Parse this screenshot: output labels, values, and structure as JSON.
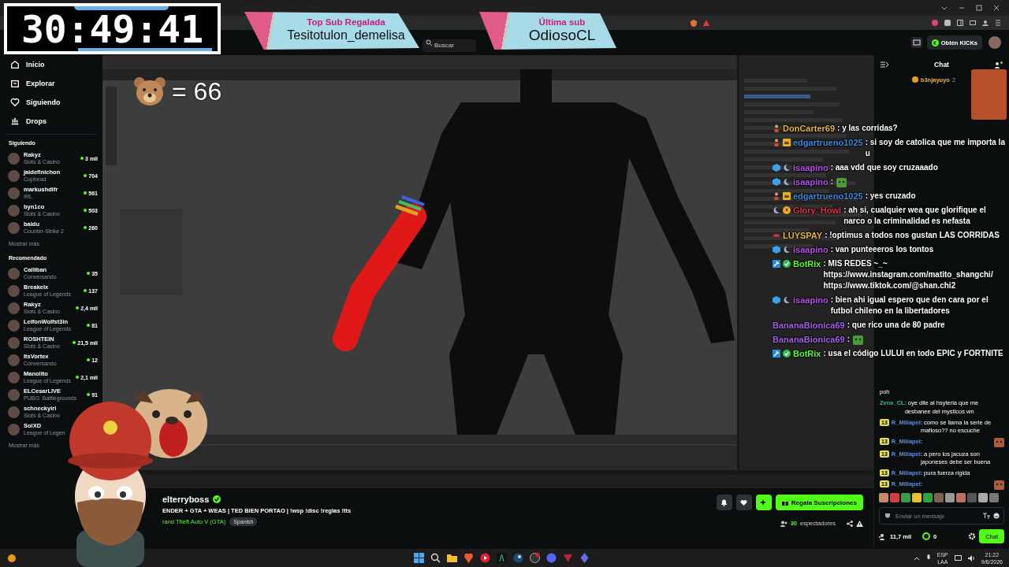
{
  "browser": {
    "search_placeholder": "Buscar",
    "kicks_button": "Obtén KICKs"
  },
  "timer": {
    "text": "30:49:41"
  },
  "banners": [
    {
      "title": "Top Sub Regalada",
      "name": "Tesitotulon_demelisa"
    },
    {
      "title": "Última sub",
      "name": "OdiosoCL"
    }
  ],
  "counter": {
    "text": "= 66"
  },
  "sidebar": {
    "nav": [
      {
        "kind": "home",
        "label": "Inicio"
      },
      {
        "kind": "explore",
        "label": "Explorar"
      },
      {
        "kind": "heart",
        "label": "Siguiendo"
      },
      {
        "kind": "drops",
        "label": "Drops"
      }
    ],
    "sections": [
      {
        "title": "Siguiendo",
        "more": "Mostrar más",
        "channels": [
          {
            "name": "Rakyz",
            "category": "Slots & Casino",
            "viewers": "3 mil"
          },
          {
            "name": "jaidefinichon",
            "category": "Cuphead",
            "viewers": "704"
          },
          {
            "name": "markushdlfr",
            "category": "IRL",
            "viewers": "561"
          },
          {
            "name": "byn1co",
            "category": "Slots & Casino",
            "viewers": "503"
          },
          {
            "name": "baldu",
            "category": "Counter-Strike 2",
            "viewers": "260"
          }
        ]
      },
      {
        "title": "Recomendado",
        "more": "Mostrar más",
        "channels": [
          {
            "name": "Calliban",
            "category": "Conversando",
            "viewers": "35"
          },
          {
            "name": "Breakelx",
            "category": "League of Legends",
            "viewers": "137"
          },
          {
            "name": "Rakyz",
            "category": "Slots & Casino",
            "viewers": "2,4 mil"
          },
          {
            "name": "LeifonWolfst3in",
            "category": "League of Legends",
            "viewers": "81"
          },
          {
            "name": "ROSHTEIN",
            "category": "Slots & Casino",
            "viewers": "21,5 mil"
          },
          {
            "name": "ItsVortex",
            "category": "Conversando",
            "viewers": "12"
          },
          {
            "name": "Manolito",
            "category": "League of Legends",
            "viewers": "2,1 mil"
          },
          {
            "name": "ELCesarLIVE",
            "category": "PUBG: Battlegrounds",
            "viewers": "91"
          },
          {
            "name": "schneckyirl",
            "category": "Slots & Casino"
          },
          {
            "name": "SolXD",
            "category": "League of Legen"
          }
        ]
      }
    ]
  },
  "overlay_chat": [
    {
      "user": "DonCarter69",
      "color": "#e8b43a",
      "badges": [
        {
          "kind": "figure"
        }
      ],
      "kind": "text",
      "text": ": y las corridas?"
    },
    {
      "user": "edgartrueno1025",
      "color": "#3a86e0",
      "badges": [
        {
          "kind": "figure"
        },
        {
          "kind": "crown"
        }
      ],
      "kind": "text",
      "text": ": si soy de catolica que me importa la u"
    },
    {
      "user": "isaapino",
      "color": "#b052e8",
      "badges": [
        {
          "kind": "cube"
        },
        {
          "kind": "moon"
        }
      ],
      "kind": "text",
      "text": ": aaa vdd que soy cruzaaado"
    },
    {
      "user": "isaapino",
      "color": "#b052e8",
      "badges": [
        {
          "kind": "cube"
        },
        {
          "kind": "moon"
        }
      ],
      "kind": "emote",
      "text": ":"
    },
    {
      "user": "edgartrueno1025",
      "color": "#3a86e0",
      "badges": [
        {
          "kind": "figure"
        },
        {
          "kind": "crown"
        }
      ],
      "kind": "text",
      "text": ": yes cruzado"
    },
    {
      "user": "Glory_Howl",
      "color": "#e03048",
      "badges": [
        {
          "kind": "moon"
        },
        {
          "kind": "coin"
        }
      ],
      "kind": "text",
      "text": ": ah si, cualquier wea que glorifique el narco o la criminalidad es nefasta"
    },
    {
      "user": "LUYSPAY",
      "color": "#e8b43a",
      "badges": [
        {
          "kind": "lips"
        }
      ],
      "kind": "text",
      "text": ": !optimus a todos nos gustan LAS CORRIDAS"
    },
    {
      "user": "isaapino",
      "color": "#b052e8",
      "badges": [
        {
          "kind": "cube"
        },
        {
          "kind": "moon"
        }
      ],
      "kind": "text",
      "text": ": van punteeeros los tontos"
    },
    {
      "user": "BotRix",
      "color": "#53fc18",
      "badges": [
        {
          "kind": "hammer"
        },
        {
          "kind": "check"
        }
      ],
      "kind": "text",
      "text": ": MIS REDES ~_~\nhttps://www.instagram.com/matito_shangchi/\nhttps://www.tiktok.com/@shan.chi2"
    },
    {
      "user": "isaapino",
      "color": "#b052e8",
      "badges": [
        {
          "kind": "cube"
        },
        {
          "kind": "moon"
        }
      ],
      "kind": "text",
      "text": ": bien ahi igual espero que den cara por el futbol chileno en la libertadores"
    },
    {
      "user": "BananaBionica69",
      "color": "#a35ee8",
      "kind": "text",
      "text": ": que rico una de 80 padre"
    },
    {
      "user": "BananaBionica69",
      "color": "#a35ee8",
      "kind": "emote",
      "text": ":"
    },
    {
      "user": "BotRix",
      "color": "#53fc18",
      "badges": [
        {
          "kind": "hammer"
        },
        {
          "kind": "check"
        }
      ],
      "kind": "text",
      "text": ": usa el código LULUI en todo EPIC y FORTNITE"
    }
  ],
  "stream": {
    "channel": "elterryboss",
    "verified": true,
    "title": "ENDER + GTA + WEAS | TED BIEN PORTAO | !wsp !disc !reglas !tts",
    "category": "rand Theft Auto V (GTA)",
    "tag": "Spanish",
    "gift_button": "Regala Suscripciones",
    "viewers": "30",
    "viewers_label": "espectadores"
  },
  "chat": {
    "title": "Chat",
    "pinned": {
      "user": "b3njayuyo",
      "count": "2"
    },
    "messages": [
      {
        "kind": "text",
        "text": "poh"
      },
      {
        "user": "Zenx_CL",
        "color": "#3fbf7f",
        "kind": "text",
        "text": ": oye dile al hsyteria que me desbanee del mysticos wn"
      },
      {
        "user": "R_Millapel",
        "color": "#5a8ee0",
        "badge": "13",
        "kind": "text",
        "text": ": como se llama la serie de mafioso?? no escuche"
      },
      {
        "user": "R_Millapel",
        "color": "#5a8ee0",
        "badge": "13",
        "kind": "emote",
        "text": ":"
      },
      {
        "user": "R_Millapel",
        "color": "#5a8ee0",
        "badge": "13",
        "kind": "text",
        "text": ": a pero los jacuza son japoneses debe ser buena"
      },
      {
        "user": "R_Millapel",
        "color": "#5a8ee0",
        "badge": "13",
        "kind": "text",
        "text": ": pura fuerza rigida"
      },
      {
        "user": "R_Millapel",
        "color": "#5a8ee0",
        "badge": "13",
        "kind": "emote",
        "text": ":"
      }
    ],
    "placeholder": "Enviar un mensaje",
    "followers": "11,7 mil",
    "kicks": "0",
    "chat_button": "Chat"
  },
  "taskbar": {
    "lang": "ESP",
    "layout": "LAA",
    "time": "21:22",
    "date": "9/6/2026"
  }
}
